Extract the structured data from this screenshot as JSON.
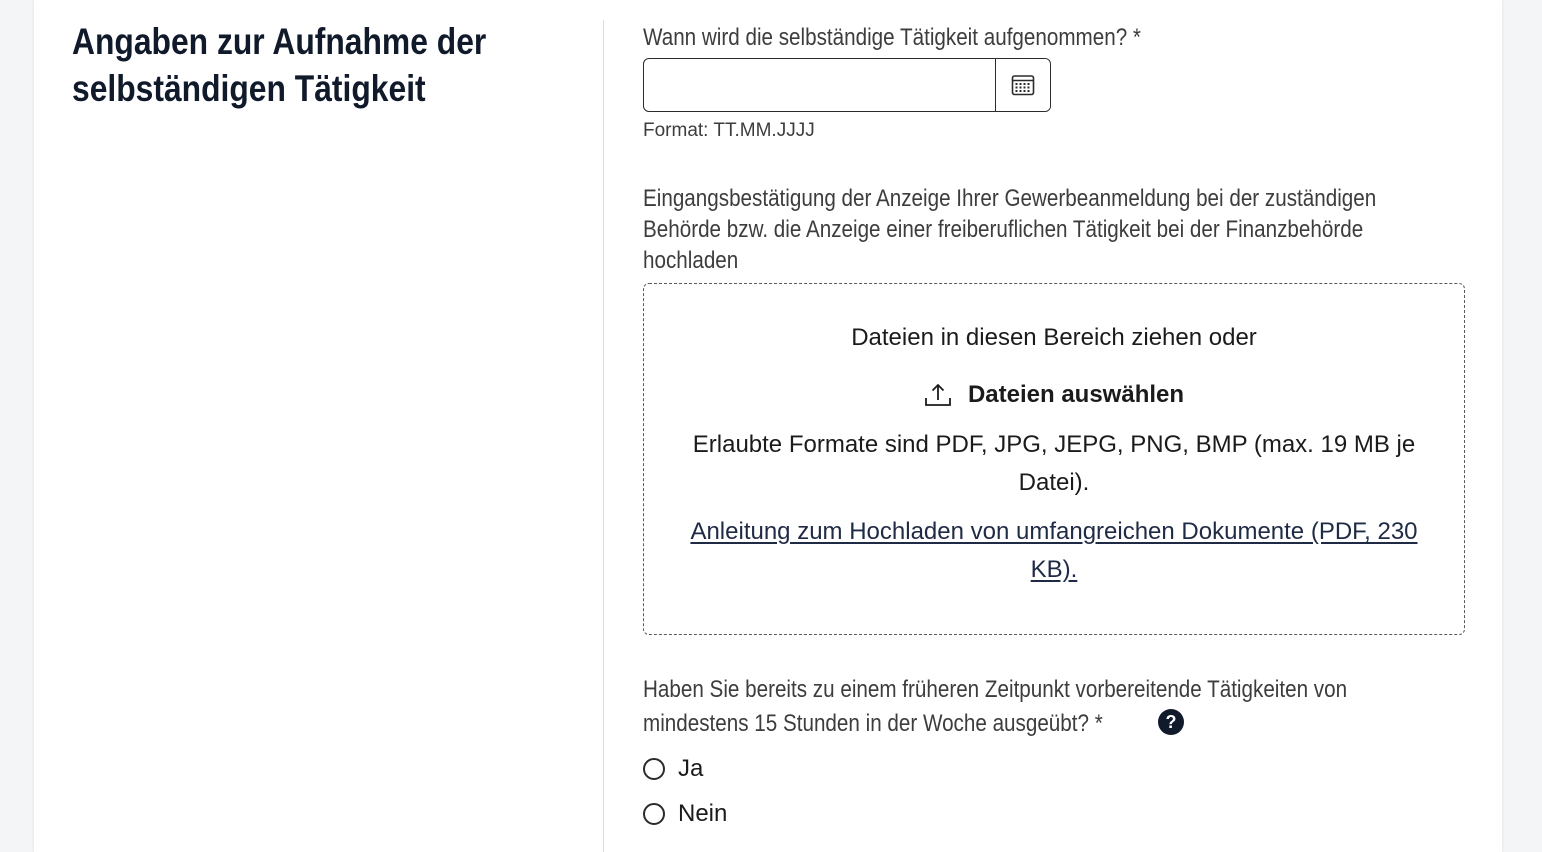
{
  "section": {
    "title": "Angaben zur Aufnahme der selbständigen Tätigkeit"
  },
  "start_date": {
    "label": "Wann wird die selbständige Tätigkeit aufgenommen? *",
    "value": "",
    "format_hint": "Format: TT.MM.JJJJ",
    "icon": "calendar-icon"
  },
  "upload": {
    "label_lines": [
      "Eingangsbestätigung der Anzeige Ihrer Gewerbeanmeldung bei der zuständigen",
      "Behörde bzw. die Anzeige einer freiberuflichen Tätigkeit bei der Finanzbehörde",
      "hochladen"
    ],
    "drop_text": "Dateien in diesen Bereich ziehen oder",
    "select_label": "Dateien auswählen",
    "select_icon": "upload-icon",
    "formats_text": "Erlaubte Formate sind PDF, JPG, JEPG, PNG, BMP (max. 19 MB je Datei).",
    "guide_link": "Anleitung zum Hochladen von umfangreichen Dokumente (PDF, 230 KB)."
  },
  "prior_activity": {
    "label_lines": [
      "Haben Sie bereits zu einem früheren Zeitpunkt vorbereitende Tätigkeiten von",
      "mindestens 15 Stunden in der Woche ausgeübt? *"
    ],
    "help_icon": "help-icon",
    "help_glyph": "?",
    "options": [
      "Ja",
      "Nein"
    ]
  },
  "colors": {
    "heading": "#101a2b",
    "label": "#3d3d3d",
    "link": "#1f2a44",
    "border": "#2b2b2b"
  }
}
